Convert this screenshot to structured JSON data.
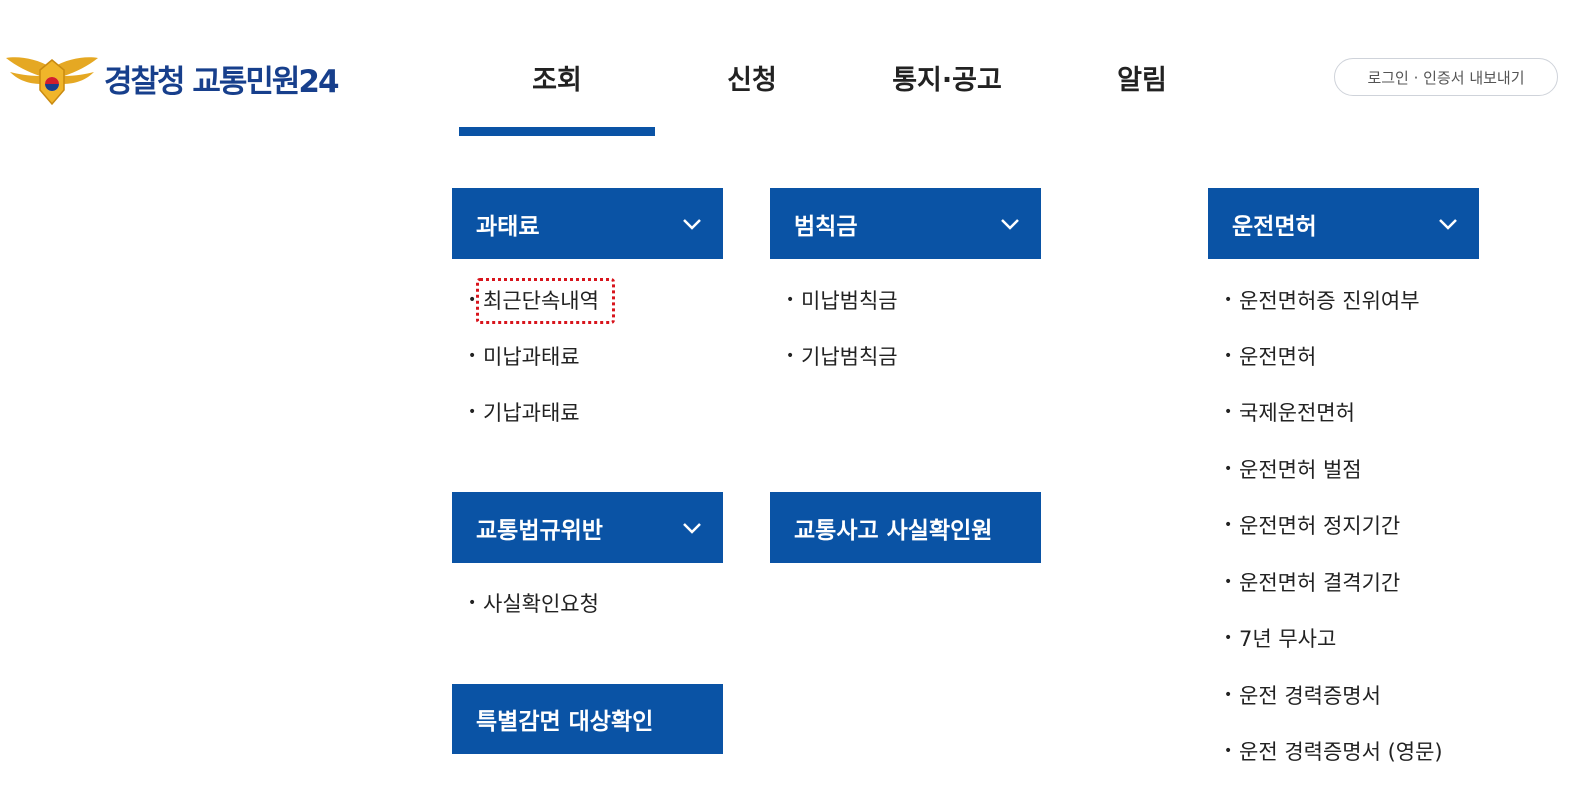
{
  "logo": {
    "text": "경찰청 교통민원24",
    "icon": "police-emblem-icon"
  },
  "nav": {
    "items": [
      "조회",
      "신청",
      "통지·공고",
      "알림"
    ],
    "active": "조회"
  },
  "login_button": "로그인 · 인증서 내보내기",
  "menu": {
    "penalty": {
      "title": "과태료",
      "items": [
        "최근단속내역",
        "미납과태료",
        "기납과태료"
      ]
    },
    "fine": {
      "title": "범칙금",
      "items": [
        "미납범칙금",
        "기납범칙금"
      ]
    },
    "license": {
      "title": "운전면허",
      "items": [
        "운전면허증 진위여부",
        "운전면허",
        "국제운전면허",
        "운전면허 벌점",
        "운전면허 정지기간",
        "운전면허 결격기간",
        "7년 무사고",
        "운전 경력증명서",
        "운전 경력증명서 (영문)"
      ]
    },
    "violation": {
      "title": "교통법규위반",
      "items": [
        "사실확인요청"
      ]
    },
    "accident": {
      "title": "교통사고 사실확인원"
    },
    "special": {
      "title": "특별감면 대상확인"
    }
  },
  "colors": {
    "primary": "#0a53a5",
    "focus_border": "#d8141c",
    "logo_text": "#173f8c"
  }
}
